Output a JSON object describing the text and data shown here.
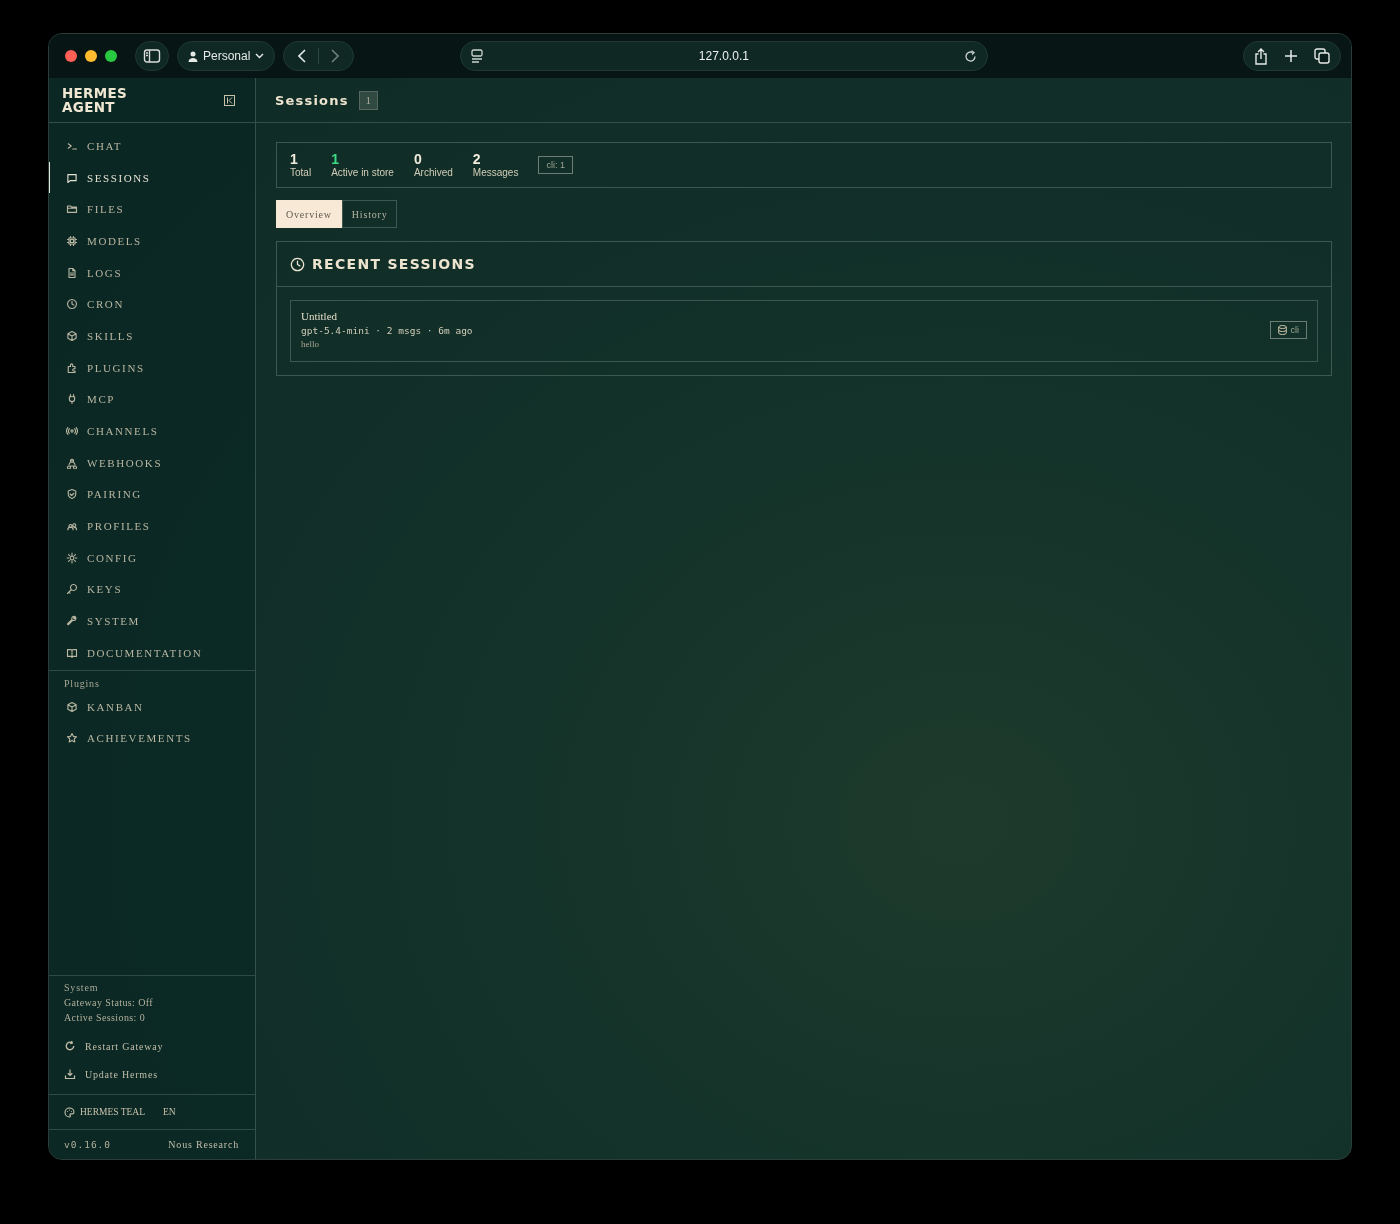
{
  "browser": {
    "profile": "Personal",
    "url": "127.0.0.1"
  },
  "sidebar": {
    "brand": "HERMES AGENT",
    "items": [
      {
        "label": "CHAT",
        "selected": false
      },
      {
        "label": "SESSIONS",
        "selected": true
      },
      {
        "label": "FILES",
        "selected": false
      },
      {
        "label": "MODELS",
        "selected": false
      },
      {
        "label": "LOGS",
        "selected": false
      },
      {
        "label": "CRON",
        "selected": false
      },
      {
        "label": "SKILLS",
        "selected": false
      },
      {
        "label": "PLUGINS",
        "selected": false
      },
      {
        "label": "MCP",
        "selected": false
      },
      {
        "label": "CHANNELS",
        "selected": false
      },
      {
        "label": "WEBHOOKS",
        "selected": false
      },
      {
        "label": "PAIRING",
        "selected": false
      },
      {
        "label": "PROFILES",
        "selected": false
      },
      {
        "label": "CONFIG",
        "selected": false
      },
      {
        "label": "KEYS",
        "selected": false
      },
      {
        "label": "SYSTEM",
        "selected": false
      },
      {
        "label": "DOCUMENTATION",
        "selected": false
      }
    ],
    "plugins_label": "Plugins",
    "plugin_items": [
      {
        "label": "KANBAN",
        "selected": false
      },
      {
        "label": "ACHIEVEMENTS",
        "selected": false
      }
    ],
    "system": {
      "title": "System",
      "gateway_status": "Gateway Status: Off",
      "active_sessions": "Active Sessions: 0"
    },
    "actions": [
      "Restart Gateway",
      "Update Hermes"
    ],
    "theme": "HERMES TEAL",
    "language": "EN",
    "version": "v0.16.0",
    "credit": "Nous Research"
  },
  "page": {
    "title": "Sessions",
    "count": "1"
  },
  "stats": [
    {
      "value": "1",
      "label": "Total",
      "highlighted": false
    },
    {
      "value": "1",
      "label": "Active in store",
      "highlighted": true
    },
    {
      "value": "0",
      "label": "Archived",
      "highlighted": false
    },
    {
      "value": "2",
      "label": "Messages",
      "highlighted": false
    }
  ],
  "filter_badge": "cli: 1",
  "tabs": [
    {
      "label": "Overview",
      "selected": true
    },
    {
      "label": "History",
      "selected": false
    }
  ],
  "recent": {
    "title": "RECENT SESSIONS",
    "sessions": [
      {
        "title": "Untitled",
        "meta": "gpt-5.4-mini · 2 msgs · 6m ago",
        "preview": "hello",
        "source": "cli"
      }
    ]
  }
}
